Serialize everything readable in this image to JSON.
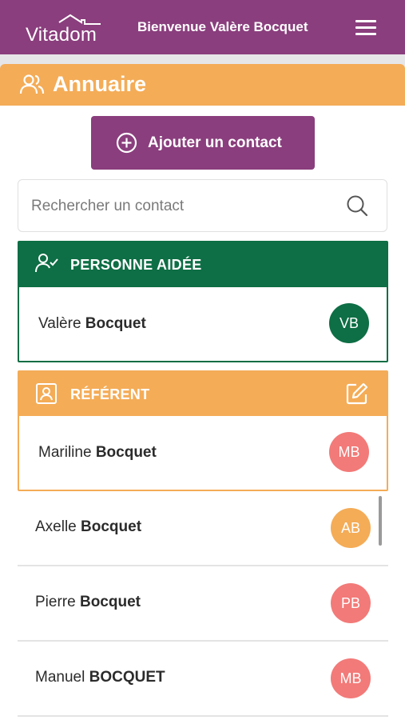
{
  "header": {
    "logo_text": "Vitadom",
    "welcome": "Bienvenue Valère Bocquet",
    "menu_icon": "hamburger-menu-icon"
  },
  "page": {
    "title": "Annuaire",
    "title_icon": "people-icon"
  },
  "add_contact": {
    "label": "Ajouter un contact",
    "icon": "plus-circle-icon"
  },
  "search": {
    "placeholder": "Rechercher un contact",
    "value": "",
    "icon": "search-icon"
  },
  "aidee": {
    "label": "PERSONNE AIDÉE",
    "icon": "user-check-icon",
    "color": "#0e6e45",
    "contact": {
      "first": "Valère",
      "last": "Bocquet",
      "initials": "VB",
      "color": "#0e6e45"
    }
  },
  "referent": {
    "label": "RÉFÉRENT",
    "icon": "contact-card-icon",
    "edit_icon": "edit-icon",
    "color": "#f4ac57",
    "contact": {
      "first": "Mariline",
      "last": "Bocquet",
      "initials": "MB",
      "color": "#f27a78"
    }
  },
  "contacts": [
    {
      "first": "Axelle",
      "last": "Bocquet",
      "initials": "AB",
      "color": "#f4ac57"
    },
    {
      "first": "Pierre",
      "last": "Bocquet",
      "initials": "PB",
      "color": "#f27a78"
    },
    {
      "first": "Manuel",
      "last": "BOCQUET",
      "initials": "MB",
      "color": "#f27a78"
    }
  ],
  "colors": {
    "brand": "#8a3e7d",
    "accent": "#f4ac57",
    "green": "#0e6e45",
    "avatar_red": "#f27a78"
  }
}
